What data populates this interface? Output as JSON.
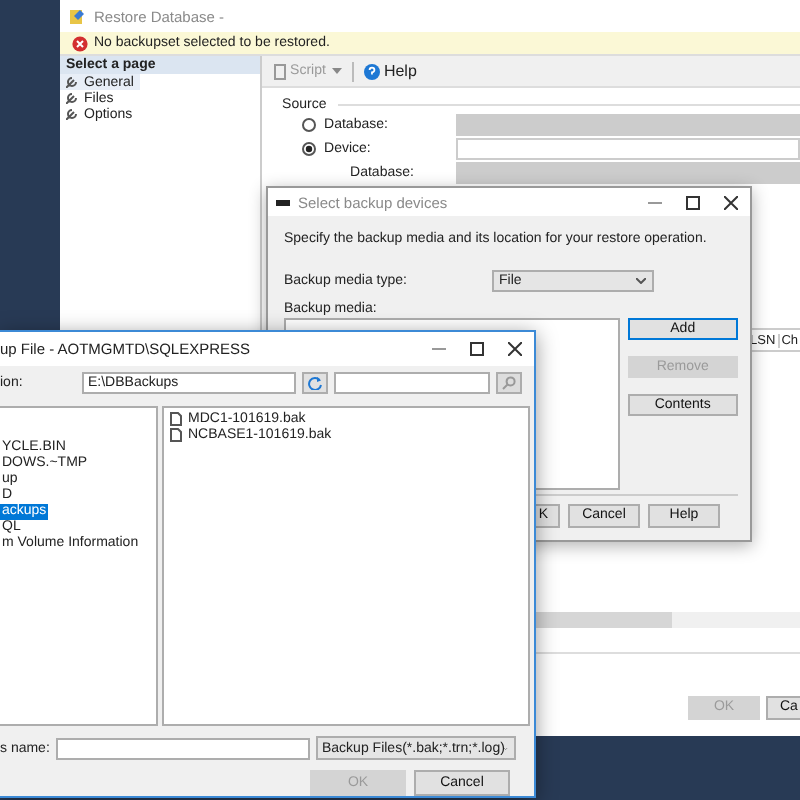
{
  "restore_window": {
    "title": "Restore Database -",
    "alert": "No backupset selected to be restored.",
    "page_header": "Select a page",
    "pages": [
      {
        "label": "General",
        "selected": true
      },
      {
        "label": "Files",
        "selected": false
      },
      {
        "label": "Options",
        "selected": false
      }
    ],
    "toolbar": {
      "script": "Script",
      "help": "Help"
    },
    "source": {
      "heading": "Source",
      "options": [
        {
          "label": "Database:",
          "selected": false
        },
        {
          "label": "Device:",
          "selected": true
        }
      ],
      "database_label": "Database:"
    },
    "grid_columns": [
      "LSN",
      "Ch"
    ],
    "buttons": [
      {
        "label": "OK",
        "disabled": true
      },
      {
        "label": "Ca",
        "disabled": false
      }
    ]
  },
  "devices_dialog": {
    "title": "Select backup devices",
    "instruction": "Specify the backup media and its location for your restore operation.",
    "media_type_label": "Backup media type:",
    "media_type": "File",
    "media_label": "Backup media:",
    "side_buttons": [
      {
        "label": "Add",
        "disabled": false
      },
      {
        "label": "Remove",
        "disabled": true
      },
      {
        "label": "Contents",
        "disabled": false
      }
    ],
    "buttons": [
      {
        "label": "K",
        "disabled": false
      },
      {
        "label": "Cancel",
        "disabled": false
      },
      {
        "label": "Help",
        "disabled": false
      }
    ]
  },
  "locate_dialog": {
    "title": "up File - AOTMGMTD\\SQLEXPRESS",
    "location_label": "ion:",
    "path": "E:\\DBBackups",
    "tree": [
      {
        "label": "YCLE.BIN",
        "selected": false
      },
      {
        "label": "DOWS.~TMP",
        "selected": false
      },
      {
        "label": "up",
        "selected": false
      },
      {
        "label": "D",
        "selected": false
      },
      {
        "label": "ackups",
        "selected": true
      },
      {
        "label": "QL",
        "selected": false
      },
      {
        "label": "m Volume Information",
        "selected": false
      }
    ],
    "files": [
      "MDC1-101619.bak",
      "NCBASE1-101619.bak"
    ],
    "file_name_label": "s name:",
    "filter": "Backup Files(*.bak;*.trn;*.log)",
    "buttons": [
      {
        "label": "OK",
        "disabled": true
      },
      {
        "label": "Cancel",
        "disabled": false
      }
    ]
  }
}
